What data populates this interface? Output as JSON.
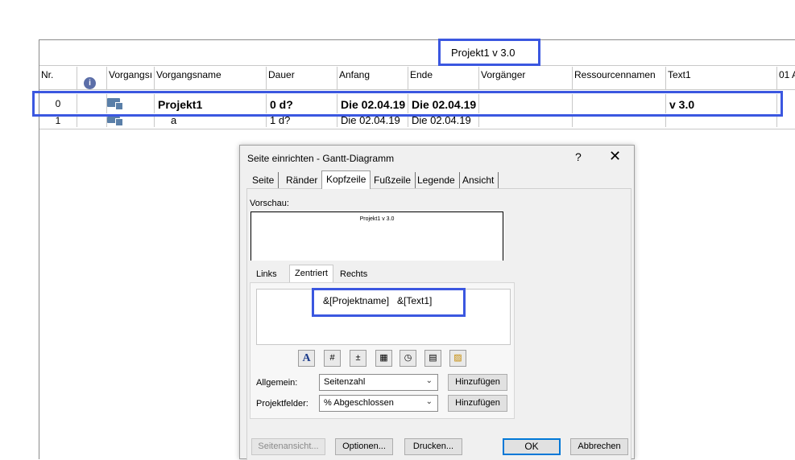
{
  "sheet": {
    "project_title": "Projekt1   v 3.0",
    "columns": [
      "Nr.",
      "Vorgangsı",
      "Vorgangsname",
      "Dauer",
      "Anfang",
      "Ende",
      "Vorgänger",
      "Ressourcennamen",
      "Text1",
      "01 A"
    ],
    "rows": [
      {
        "nr": "0",
        "name": "Projekt1",
        "dauer": "0 d?",
        "anfang": "Die 02.04.19",
        "ende": "Die 02.04.19",
        "vorgaenger": "",
        "ressourcen": "",
        "text1": "v 3.0"
      },
      {
        "nr": "1",
        "name": "a",
        "dauer": "1 d?",
        "anfang": "Die 02.04.19",
        "ende": "Die 02.04.19",
        "vorgaenger": "",
        "ressourcen": "",
        "text1": ""
      }
    ],
    "highlight_color": "#3b57e0"
  },
  "dialog": {
    "title": "Seite einrichten - Gantt-Diagramm",
    "help_label": "?",
    "close_label": "✕",
    "tabs": [
      "Seite",
      "Ränder",
      "Kopfzeile",
      "Fußzeile",
      "Legende",
      "Ansicht"
    ],
    "active_tab": "Kopfzeile",
    "preview_label": "Vorschau:",
    "preview_text": "Projekt1   v 3.0",
    "subtabs": [
      "Links",
      "Zentriert",
      "Rechts"
    ],
    "active_subtab": "Zentriert",
    "header_content": "&[Projektname]   &[Text1]",
    "format_icons": [
      "font-icon",
      "page-number-icon",
      "page-count-icon",
      "date-icon",
      "time-icon",
      "file-name-icon",
      "picture-icon"
    ],
    "allgemein_label": "Allgemein:",
    "allgemein_value": "Seitenzahl",
    "projektfelder_label": "Projektfelder:",
    "projektfelder_value": "% Abgeschlossen",
    "add_button_1": "Hinzufügen",
    "add_button_2": "Hinzufügen",
    "footer_buttons": {
      "seitenansicht": "Seitenansicht...",
      "optionen": "Optionen...",
      "drucken": "Drucken...",
      "ok": "OK",
      "abbrechen": "Abbrechen"
    }
  }
}
